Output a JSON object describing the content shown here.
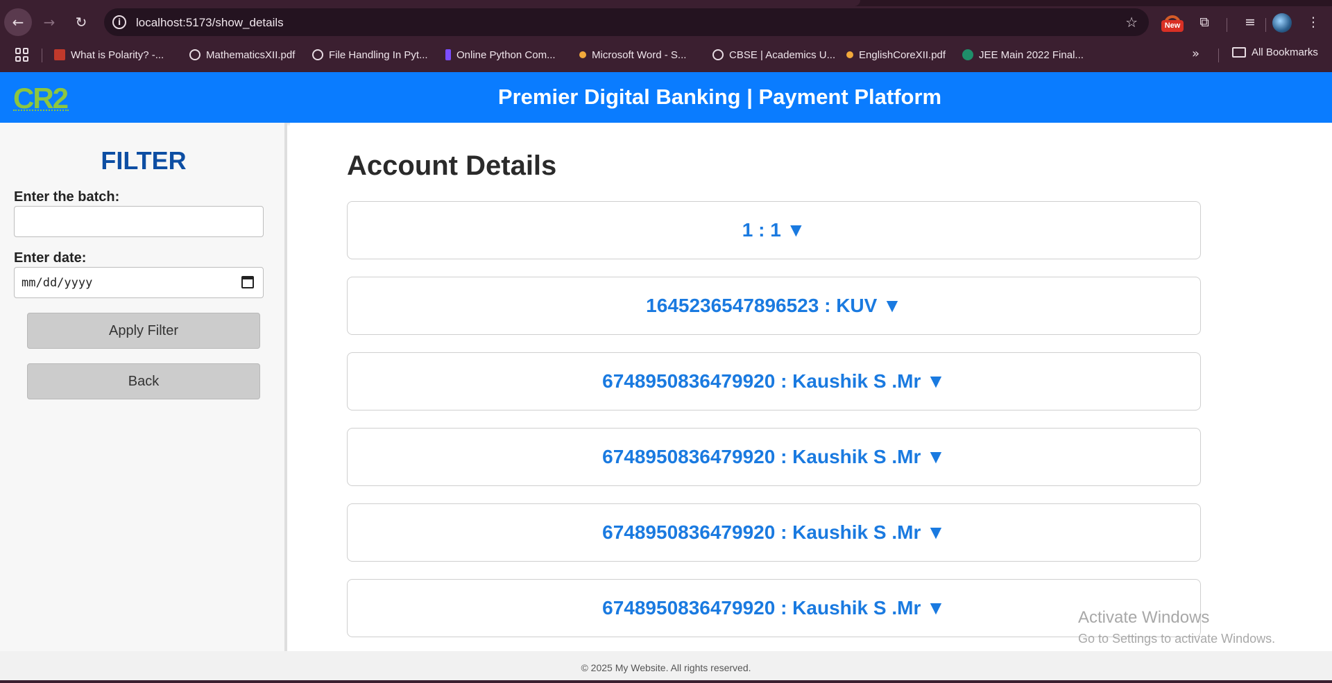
{
  "browser": {
    "url": "localhost:5173/show_details",
    "new_badge": "New",
    "bookmarks": [
      {
        "label": "What is Polarity? -...",
        "color": "#c0392b"
      },
      {
        "label": "MathematicsXII.pdf",
        "color": "#e8dce3"
      },
      {
        "label": "File Handling In Pyt...",
        "color": "#e8dce3"
      },
      {
        "label": "Online Python Com...",
        "color": "#7b4dff"
      },
      {
        "label": "Microsoft Word - S...",
        "color": "#f2a93b"
      },
      {
        "label": "CBSE | Academics U...",
        "color": "#e8dce3"
      },
      {
        "label": "EnglishCoreXII.pdf",
        "color": "#f2a93b"
      },
      {
        "label": "JEE Main 2022 Final...",
        "color": "#1f8f6a"
      }
    ],
    "all_bookmarks": "All Bookmarks"
  },
  "header": {
    "logo": "CR2",
    "title": "Premier Digital Banking | Payment Platform"
  },
  "sidebar": {
    "title": "FILTER",
    "batch_label": "Enter the batch:",
    "batch_value": "",
    "date_label": "Enter date:",
    "date_placeholder": "mm/dd/yyyy",
    "apply_button": "Apply Filter",
    "back_button": "Back"
  },
  "main": {
    "title": "Account Details",
    "accounts": [
      "1 : 1 ▼",
      "1645236547896523 : KUV ▼",
      "6748950836479920 : Kaushik S .Mr ▼",
      "6748950836479920 : Kaushik S .Mr ▼",
      "6748950836479920 : Kaushik S .Mr ▼",
      "6748950836479920 : Kaushik S .Mr ▼"
    ]
  },
  "watermark": {
    "line1": "Activate Windows",
    "line2": "Go to Settings to activate Windows."
  },
  "footer": {
    "text": "© 2025 My Website. All rights reserved."
  },
  "colors": {
    "header_bg": "#0a7cff",
    "logo": "#8dc63f",
    "filter_title": "#0d4ea3",
    "account_text": "#1a7ae0"
  }
}
